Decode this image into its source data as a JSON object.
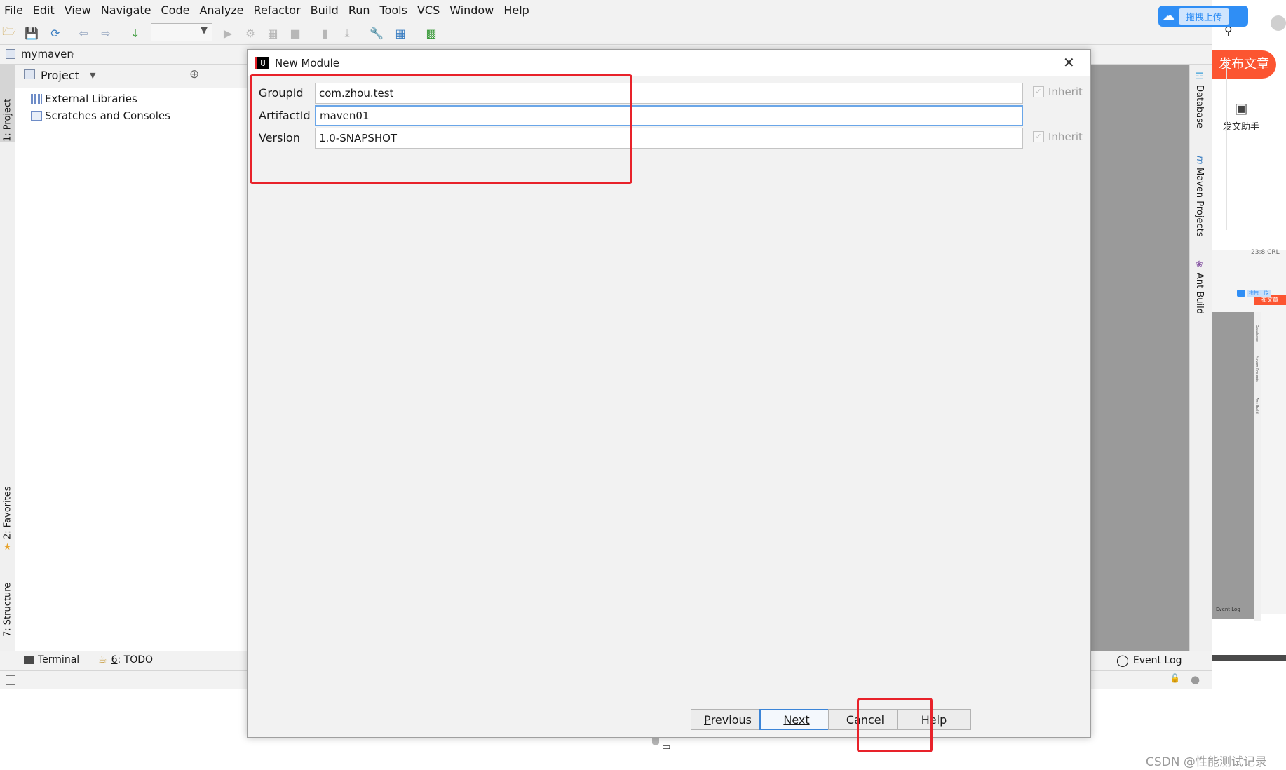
{
  "menu": [
    "File",
    "Edit",
    "View",
    "Navigate",
    "Code",
    "Analyze",
    "Refactor",
    "Build",
    "Run",
    "Tools",
    "VCS",
    "Window",
    "Help"
  ],
  "navbar": {
    "crumb": "mymaven"
  },
  "left_tabs": {
    "project": "1: Project",
    "favorites": "2: Favorites",
    "structure": "7: Structure"
  },
  "project_panel": {
    "header": "Project",
    "items": [
      {
        "label": "External Libraries",
        "icon": "library-icon"
      },
      {
        "label": "Scratches and Consoles",
        "icon": "scratches-icon"
      }
    ]
  },
  "right_tabs": {
    "database": "Database",
    "maven": "Maven Projects",
    "ant": "Ant Build"
  },
  "bottom_bar": {
    "terminal": "Terminal",
    "todo_num": "6",
    "todo": ": TODO",
    "event_log": "Event Log"
  },
  "dialog": {
    "title": "New Module",
    "fields": [
      {
        "label": "GroupId",
        "value": "com.zhou.test",
        "inherit": "Inherit"
      },
      {
        "label": "ArtifactId",
        "value": "maven01"
      },
      {
        "label": "Version",
        "value": "1.0-SNAPSHOT",
        "inherit": "Inherit"
      }
    ],
    "buttons": {
      "previous_mn": "P",
      "previous_rest": "revious",
      "next_mn": "N",
      "next_rest": "ext",
      "cancel": "Cancel",
      "help": "Help"
    }
  },
  "external": {
    "upload_label": "拖拽上传",
    "publish": "发布文章",
    "assistant": "发文助手",
    "mini_publish": "布文章",
    "mini_upload": "拖拽上传",
    "mini_event_log": "Event Log",
    "mini_tabs": [
      "Database",
      "Maven Projects",
      "Ant Build"
    ],
    "status_text": "23:8 CRL"
  },
  "watermark": "CSDN @性能测试记录",
  "colors": {
    "highlight_box": "#e8222a",
    "focus": "#6aa6e8",
    "primary_btn": "#3c85d8",
    "publish_btn": "#fc5531"
  }
}
